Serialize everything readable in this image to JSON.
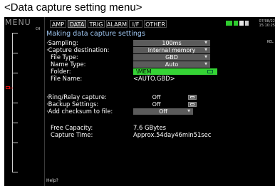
{
  "caption": "<Data capture setting menu>",
  "sidebar": {
    "menu_label": "MENU",
    "channel_label": "CH"
  },
  "tabs": [
    {
      "label": "AMP"
    },
    {
      "label": "DATA"
    },
    {
      "label": "TRIG"
    },
    {
      "label": "ALARM"
    },
    {
      "label": "I/F"
    },
    {
      "label": "OTHER"
    }
  ],
  "active_tab": "DATA",
  "clock": {
    "date": "07/08/22",
    "time": "15:10:25"
  },
  "relay_tag": "REL",
  "panel_title": "Making data capture settings",
  "settings": {
    "sampling": {
      "label": "·Sampling:",
      "value": "100ms"
    },
    "destination": {
      "label": "·Capture destination:",
      "value": "Internal memory"
    },
    "file_type": {
      "label": "File Type:",
      "value": "GBD"
    },
    "name_type": {
      "label": "Name Type:",
      "value": "Auto"
    },
    "folder": {
      "label": "Folder:",
      "value": "\\MEM"
    },
    "file_name": {
      "label": "File Name:",
      "value": "<AUTO.GBD>"
    },
    "ring_relay": {
      "label": "·Ring/Relay capture:",
      "value": "Off"
    },
    "backup": {
      "label": "·Backup Settings:",
      "value": "Off"
    },
    "checksum": {
      "label": "·Add checksum to file:",
      "value": "Off"
    }
  },
  "info": {
    "free_capacity": {
      "label": "Free Capacity:",
      "value": "7.6 GBytes"
    },
    "capture_time": {
      "label": "Capture Time:",
      "value": "Approx.54day46min51sec"
    }
  },
  "help_text": "Help?",
  "colors": {
    "title": "#9ec5f0",
    "folder_field": "#35d335",
    "dropdown": "#5b5b5b",
    "marker": "#e01010"
  }
}
